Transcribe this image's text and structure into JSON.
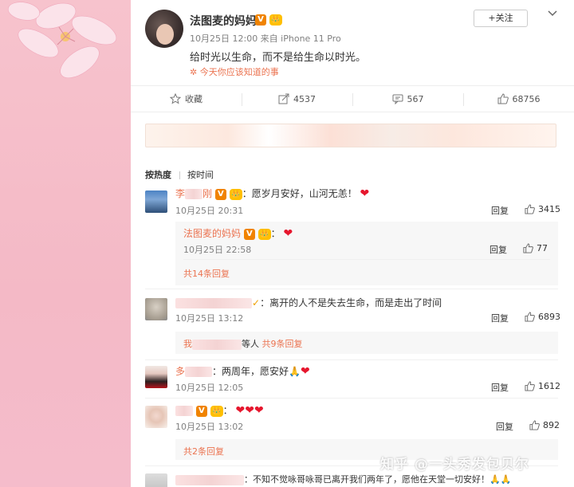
{
  "post": {
    "author": "法图麦的妈妈",
    "vip_badge": "V",
    "crown_badge": "👑",
    "meta": "10月25日 12:00 来自 iPhone 11 Pro",
    "text": "给时光以生命，而不是给生命以时光。",
    "topic": "✲ 今天你应该知道的事",
    "follow_label": "+关注"
  },
  "actions": {
    "favorite": "收藏",
    "repost": "4537",
    "comment": "567",
    "like": "68756"
  },
  "sort": {
    "hot": "按热度",
    "time": "按时间"
  },
  "comments": [
    {
      "name_visible": "李",
      "name_tail": "刚",
      "text": "：愿岁月安好，山河无恙！",
      "time": "10月25日 20:31",
      "reply": "回复",
      "likes": "3415",
      "sub": {
        "name": "法图麦的妈妈",
        "text": "：",
        "time": "10月25日 22:58",
        "reply": "回复",
        "likes": "77"
      },
      "more": "共14条回复"
    },
    {
      "text": "：离开的人不是失去生命，而是走出了时间",
      "time": "10月25日 13:12",
      "reply": "回复",
      "likes": "6893",
      "sub_prefix": "我",
      "sub_text": "等人",
      "sub_more": "共9条回复"
    },
    {
      "name_visible": "多",
      "text": "：两周年，愿安好🙏",
      "time": "10月25日 12:05",
      "reply": "回复",
      "likes": "1612"
    },
    {
      "text": "",
      "time": "10月25日 13:02",
      "reply": "回复",
      "likes": "892",
      "more": "共2条回复"
    },
    {
      "text": "：不知不觉咏哥咏哥已离开我们两年了，愿他在天堂一切安好！🙏🙏"
    }
  ],
  "watermark": "知乎 @一头秀发包贝尔",
  "colors": {
    "accent": "#eb7350",
    "heart": "#e6162d",
    "background": "#f9c9d2"
  }
}
